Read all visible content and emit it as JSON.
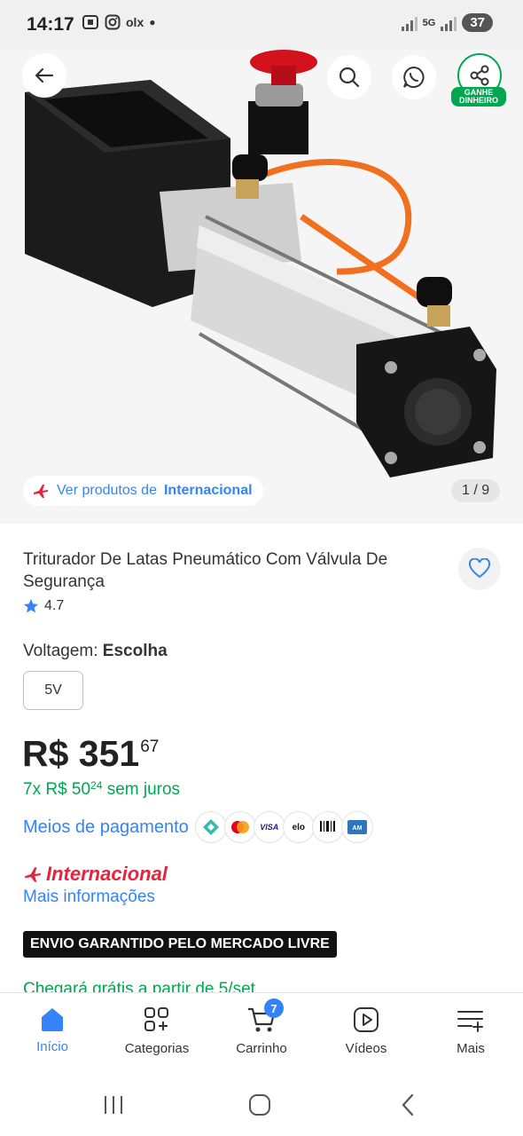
{
  "status": {
    "time": "14:17",
    "left_icons": [
      "screenshot-icon",
      "instagram-icon",
      "olx-icon"
    ],
    "olx_text": "olx",
    "network": "5G",
    "battery": "37"
  },
  "gallery": {
    "intl_prefix": "Ver produtos de",
    "intl_bold": "Internacional",
    "counter": "1 / 9",
    "share_badge": "GANHE DINHEIRO"
  },
  "product": {
    "title": "Triturador De Latas Pneumático Com Válvula De Segurança",
    "rating": "4.7",
    "variant_label": "Voltagem:",
    "variant_value": "Escolha",
    "variant_option": "5V",
    "price_main": "R$ 351",
    "price_cents": "67",
    "install_text_pre": "7x R$ 50",
    "install_cents": "24",
    "install_text_post": "sem juros",
    "payment_link": "Meios de pagamento",
    "payment_icons": [
      "pix",
      "mastercard",
      "visa",
      "elo",
      "boleto",
      "amex"
    ],
    "intl_brand": "Internacional",
    "more_info": "Mais informações",
    "envio": "ENVIO GARANTIDO PELO MERCADO LIVRE",
    "arrival": "Chegará grátis a partir de 5/set"
  },
  "nav": {
    "home": "Início",
    "categories": "Categorias",
    "cart": "Carrinho",
    "cart_count": "7",
    "videos": "Vídeos",
    "more": "Mais"
  },
  "colors": {
    "accent": "#3483fa",
    "green": "#00a650",
    "red": "#e3253f"
  }
}
